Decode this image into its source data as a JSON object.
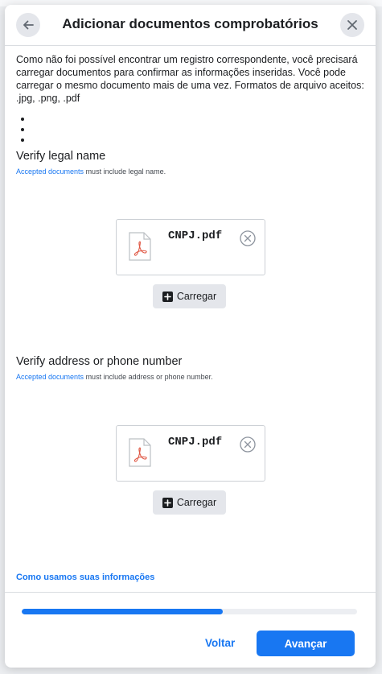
{
  "dialog": {
    "title": "Adicionar documentos comprobatórios",
    "intro": "Como não foi possível encontrar um registro correspondente, você precisará carregar documentos para confirmar as informações inseridas. Você pode carregar o mesmo documento mais de uma vez. Formatos de arquivo aceitos: .jpg, .png, .pdf",
    "bullet_count": 3
  },
  "sections": [
    {
      "title": "Verify legal name",
      "note_link": "Accepted documents",
      "note_text": " must include legal name.",
      "file": {
        "name": "CNPJ.pdf",
        "icon": "pdf-icon"
      },
      "upload_label": "Carregar"
    },
    {
      "title": "Verify address or phone number",
      "note_link": "Accepted documents",
      "note_text": " must include address or phone number.",
      "file": {
        "name": "CNPJ.pdf",
        "icon": "pdf-icon"
      },
      "upload_label": "Carregar"
    }
  ],
  "footer": {
    "info_link": "Como usamos suas informações",
    "progress": 0.6,
    "back_label": "Voltar",
    "next_label": "Avançar"
  },
  "colors": {
    "accent": "#1877f2",
    "button_gray": "#e4e6eb",
    "pdf_red": "#e05a47"
  }
}
